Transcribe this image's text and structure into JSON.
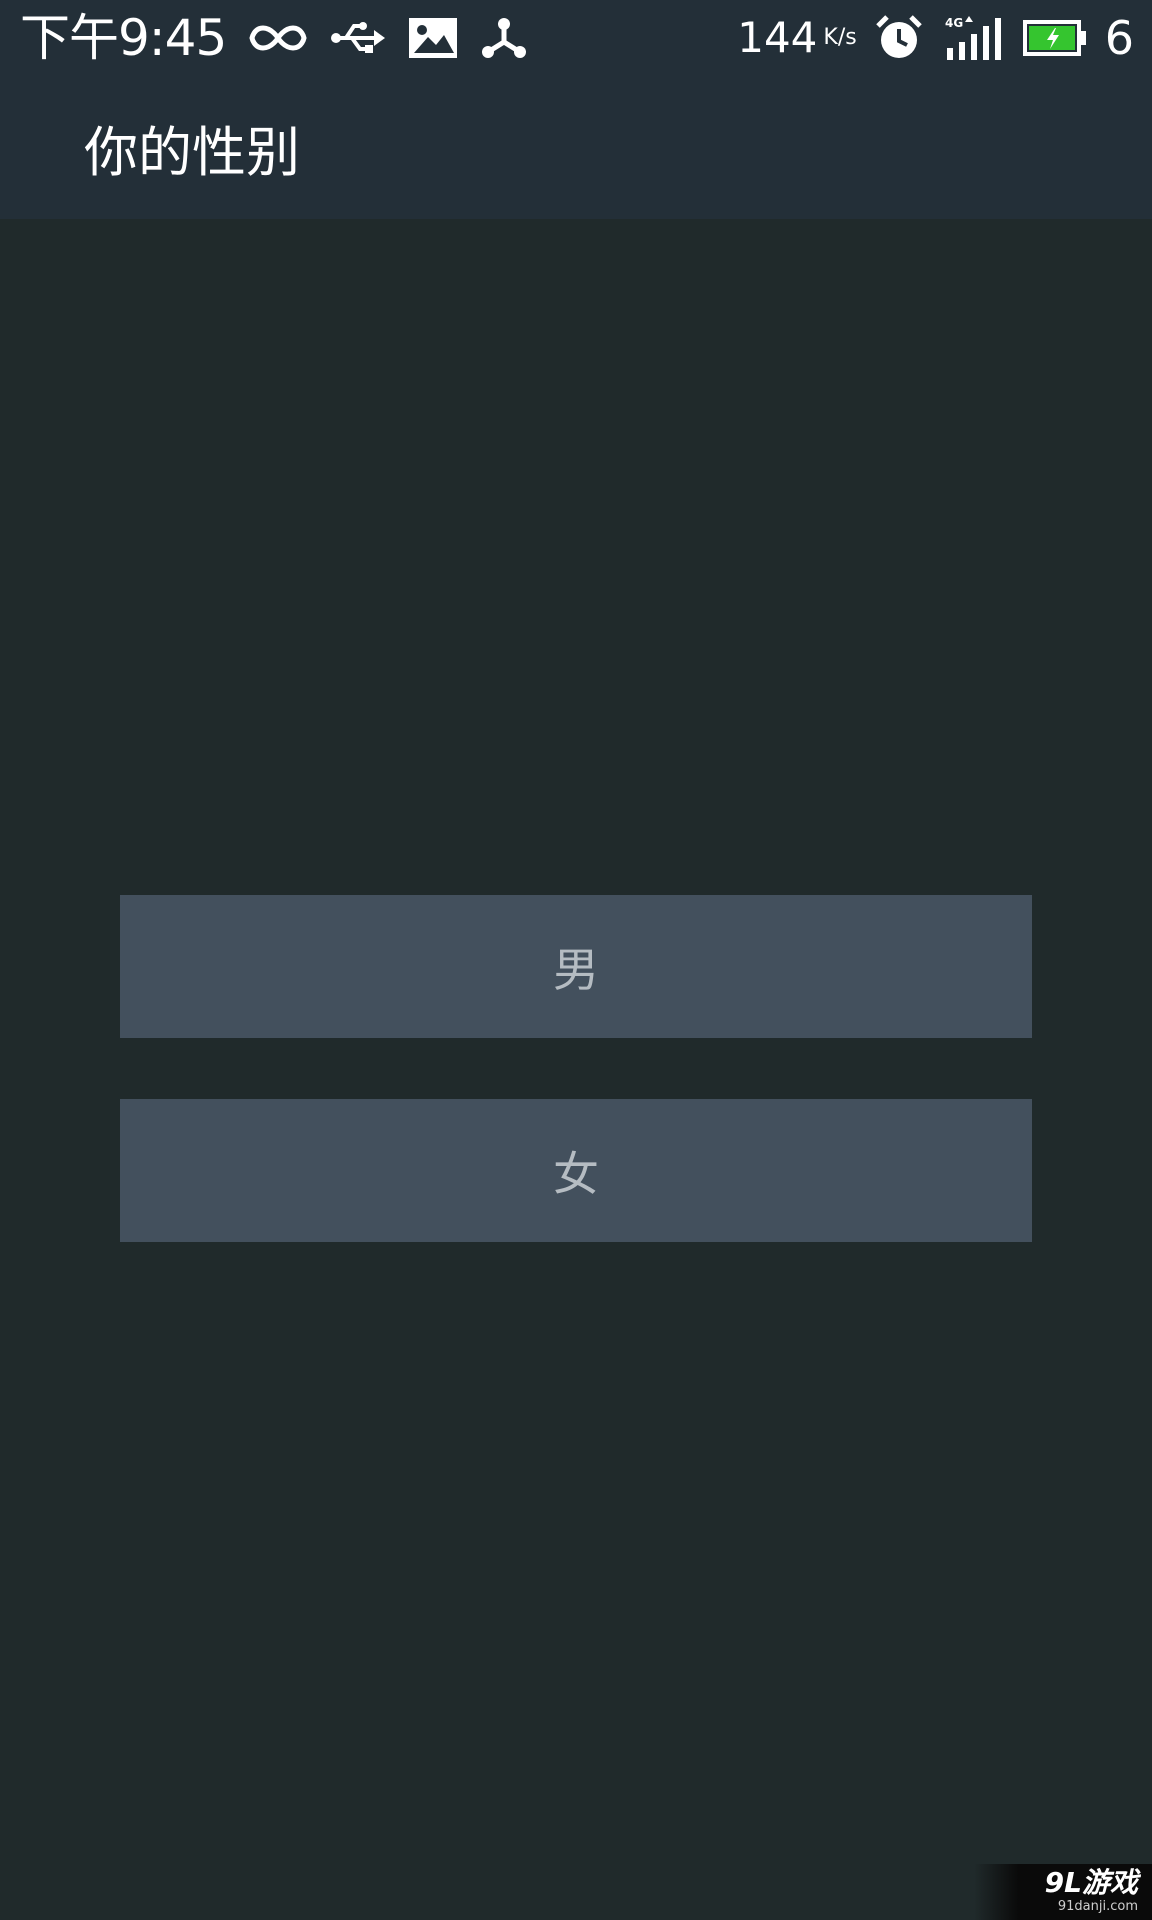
{
  "status_bar": {
    "time": "下午9:45",
    "icons_left": [
      "infinity-icon",
      "usb-icon",
      "image-icon",
      "share-hub-icon"
    ],
    "net_speed": "144",
    "net_speed_unit": "K/s",
    "icons_right": [
      "alarm-clock-icon",
      "signal-4g-icon",
      "battery-charging-icon"
    ],
    "battery_level": "6"
  },
  "app_bar": {
    "title": "你的性别"
  },
  "options": {
    "male_label": "男",
    "female_label": "女"
  },
  "watermark": {
    "logo": "9L游戏",
    "url": "91danji.com"
  },
  "colors": {
    "bar_bg": "#232f38",
    "page_bg": "#202a2b",
    "button_bg": "#43505d",
    "button_text": "#b5bcc2",
    "battery_fill": "#35c52f"
  }
}
